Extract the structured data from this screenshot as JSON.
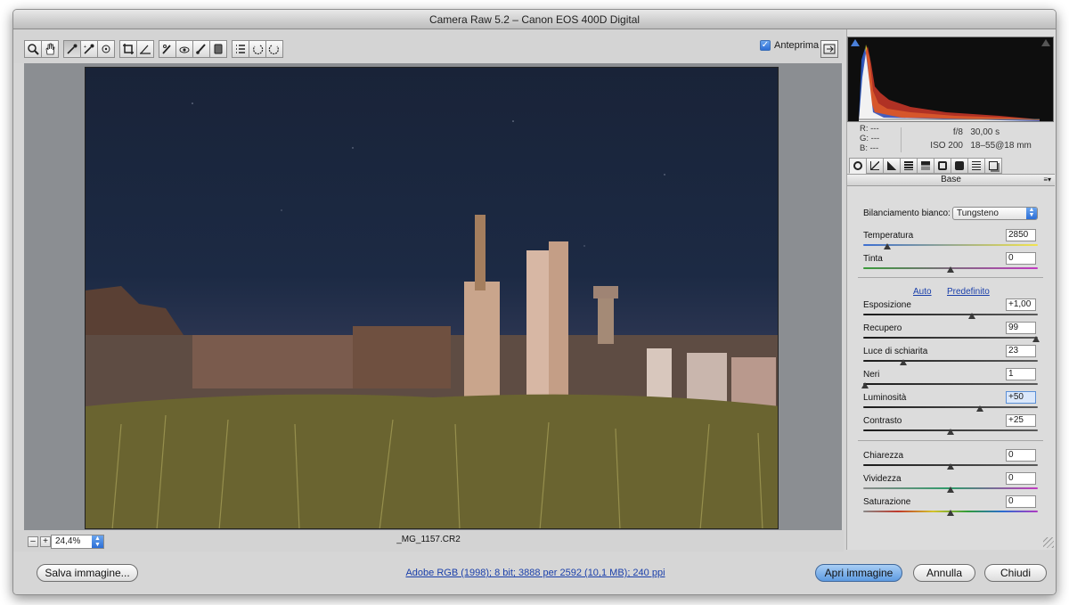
{
  "window": {
    "title": "Camera Raw 5.2  –  Canon EOS 400D Digital"
  },
  "toolbar": {
    "tools": [
      "zoom-icon",
      "hand-icon",
      "white-balance-icon",
      "color-sampler-icon",
      "targeted-adjustment-icon",
      "crop-icon",
      "straighten-icon",
      "spot-removal-icon",
      "red-eye-icon",
      "adjustment-brush-icon",
      "graduated-filter-icon",
      "preferences-icon",
      "rotate-left-icon",
      "rotate-right-icon"
    ],
    "active_tool": "white-balance-icon",
    "preview_label": "Anteprima",
    "preview_checked": true
  },
  "status": {
    "zoom": "24,4%",
    "filename": "_MG_1157.CR2",
    "zoom_out": "–",
    "zoom_in": "+"
  },
  "footer": {
    "save_label": "Salva immagine...",
    "workflow_link": "Adobe RGB (1998); 8 bit; 3888 per 2592 (10,1 MB); 240 ppi",
    "open_label": "Apri immagine",
    "cancel_label": "Annulla",
    "done_label": "Chiudi"
  },
  "info": {
    "r": "R:  ---",
    "g": "G:  ---",
    "b": "B:  ---",
    "aperture": "f/8",
    "shutter": "30,00 s",
    "iso": "ISO 200",
    "lens": "18–55@18 mm"
  },
  "panel": {
    "title": "Base",
    "wb_label": "Bilanciamento bianco:",
    "wb_value": "Tungsteno",
    "auto_label": "Auto",
    "default_label": "Predefinito",
    "sliders": [
      {
        "label": "Temperatura",
        "value": "2850",
        "pos": 0.14,
        "track": "temp"
      },
      {
        "label": "Tinta",
        "value": "0",
        "pos": 0.5,
        "track": "tint"
      },
      {
        "label": "Esposizione",
        "value": "+1,00",
        "pos": 0.62,
        "track": "gray"
      },
      {
        "label": "Recupero",
        "value": "99",
        "pos": 0.99,
        "track": "gray"
      },
      {
        "label": "Luce di schiarita",
        "value": "23",
        "pos": 0.23,
        "track": "gray"
      },
      {
        "label": "Neri",
        "value": "1",
        "pos": 0.01,
        "track": "gray"
      },
      {
        "label": "Luminosità",
        "value": "+50",
        "pos": 0.67,
        "track": "gray",
        "highlight": true
      },
      {
        "label": "Contrasto",
        "value": "+25",
        "pos": 0.5,
        "track": "gray"
      },
      {
        "label": "Chiarezza",
        "value": "0",
        "pos": 0.5,
        "track": "gray"
      },
      {
        "label": "Vividezza",
        "value": "0",
        "pos": 0.5,
        "track": "vib"
      },
      {
        "label": "Saturazione",
        "value": "0",
        "pos": 0.5,
        "track": "sat"
      }
    ]
  }
}
